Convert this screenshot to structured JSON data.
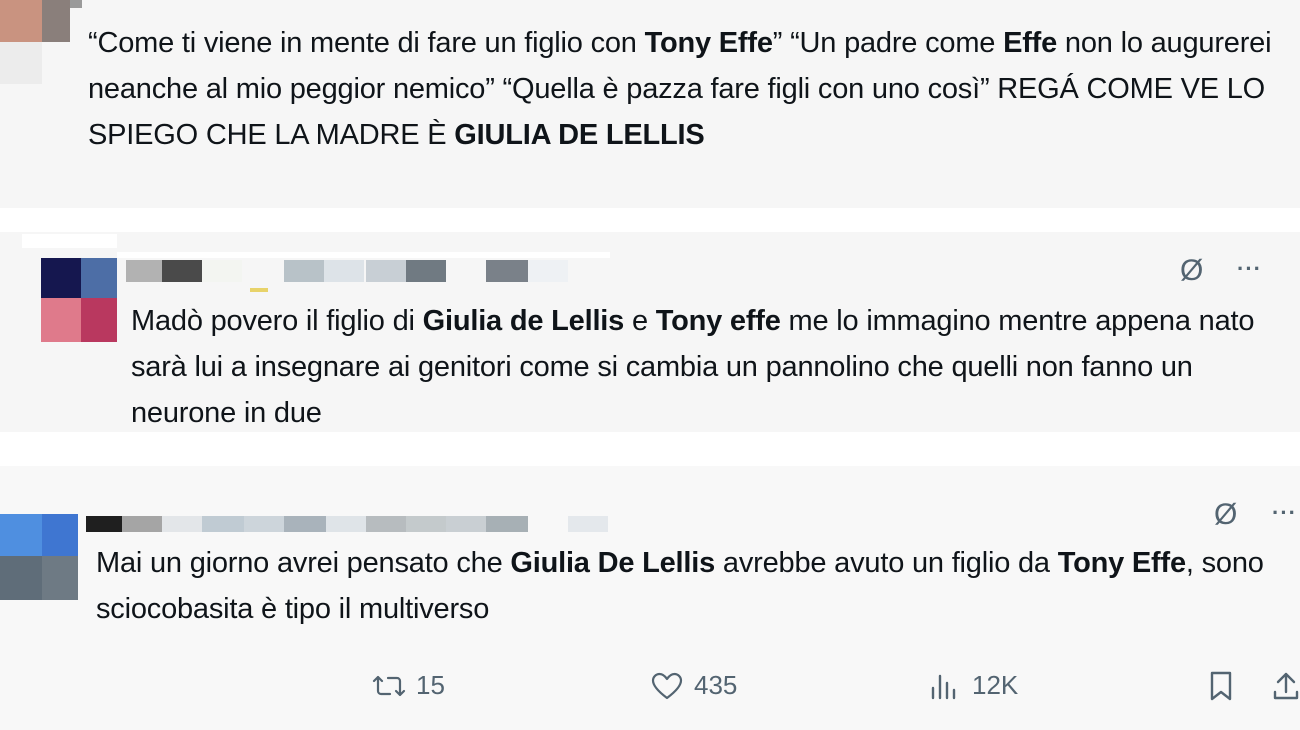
{
  "tweets": [
    {
      "segments": [
        {
          "t": "“Come ti viene in mente di fare un figlio con ",
          "b": false
        },
        {
          "t": "Tony Effe",
          "b": true
        },
        {
          "t": "” “Un padre come ",
          "b": false
        },
        {
          "t": "Effe",
          "b": true
        },
        {
          "t": " non lo augurerei neanche al mio peggior nemico” “Quella è pazza fare figli con uno così” REGÁ COME VE LO SPIEGO CHE LA MADRE È ",
          "b": false
        },
        {
          "t": "GIULIA DE LELLIS",
          "b": true
        }
      ]
    },
    {
      "segments": [
        {
          "t": "Madò povero il figlio di ",
          "b": false
        },
        {
          "t": "Giulia de Lellis",
          "b": true
        },
        {
          "t": " e ",
          "b": false
        },
        {
          "t": "Tony effe",
          "b": true
        },
        {
          "t": " me lo immagino mentre appena nato sarà lui a insegnare ai genitori come si cambia un pannolino che quelli non fanno un neurone in due",
          "b": false
        }
      ]
    },
    {
      "segments": [
        {
          "t": "Mai un giorno avrei pensato che ",
          "b": false
        },
        {
          "t": "Giulia De Lellis",
          "b": true
        },
        {
          "t": " avrebbe avuto un figlio da ",
          "b": false
        },
        {
          "t": "Tony Effe",
          "b": true
        },
        {
          "t": ", sono sciocobasita è tipo il multiverso",
          "b": false
        }
      ]
    }
  ],
  "actions": {
    "retweet_count": "15",
    "like_count": "435",
    "views_count": "12K"
  },
  "icons": {
    "grok": "Ø",
    "more": "···",
    "retweet": "retweet-icon",
    "like": "heart-icon",
    "views": "bar-chart-icon",
    "bookmark": "bookmark-icon",
    "share": "share-icon"
  }
}
